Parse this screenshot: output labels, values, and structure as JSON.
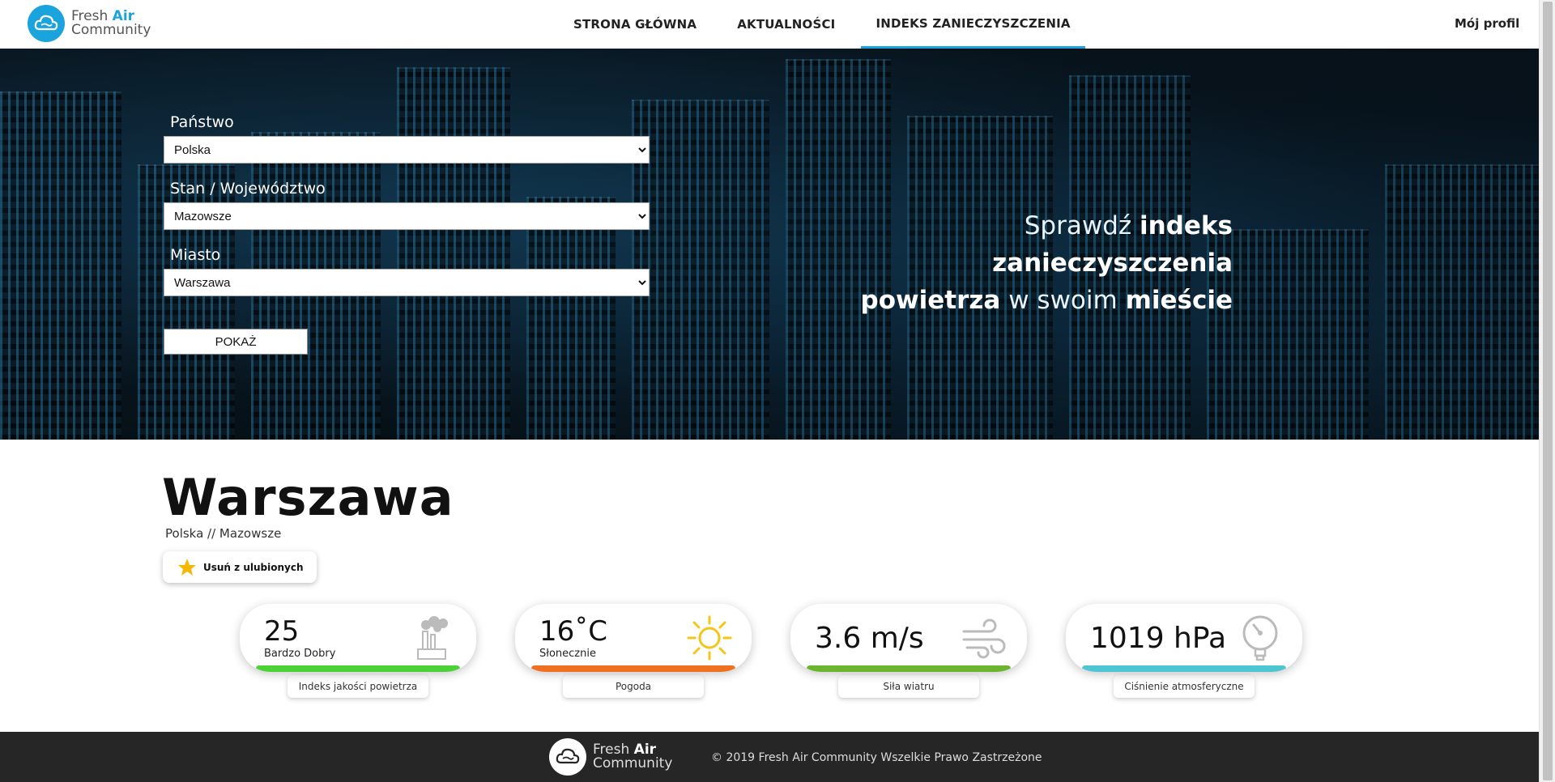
{
  "logo": {
    "line1_a": "Fresh",
    "line1_b": "Air",
    "line2": "Community"
  },
  "nav": {
    "items": [
      {
        "label": "STRONA GŁÓWNA"
      },
      {
        "label": "AKTUALNOŚCI"
      },
      {
        "label": "INDEKS ZANIECZYSZCZENIA"
      }
    ],
    "active_index": 2,
    "profile_label": "Mój profil"
  },
  "search_form": {
    "country_label": "Państwo",
    "country_value": "Polska",
    "state_label": "Stan / Województwo",
    "state_value": "Mazowsze",
    "city_label": "Miasto",
    "city_value": "Warszawa",
    "show_button": "POKAŻ"
  },
  "hero_text": {
    "part1": "Sprawdź ",
    "part2": "indeks zanieczyszczenia",
    "part3": "powietrza",
    "part4": " w swoim ",
    "part5": "mieście"
  },
  "city": {
    "name": "Warszawa",
    "breadcrumb": "Polska // Mazowsze",
    "favorite_button": "Usuń z ulubionych"
  },
  "cards": [
    {
      "value": "25",
      "sub": "Bardzo Dobry",
      "label": "Indeks jakości powietrza",
      "bar_color": "#4cd137",
      "icon": "factory-icon"
    },
    {
      "value": "16˚C",
      "sub": "Słonecznie",
      "label": "Pogoda",
      "bar_color": "#f07021",
      "icon": "sun-icon"
    },
    {
      "value": "3.6 m/s",
      "sub": "",
      "label": "Siła wiatru",
      "bar_color": "#6ab42e",
      "icon": "wind-icon"
    },
    {
      "value": "1019 hPa",
      "sub": "",
      "label": "Ciśnienie atmosferyczne",
      "bar_color": "#4ec5d3",
      "icon": "gauge-icon"
    }
  ],
  "footer": {
    "logo_line1_a": "Fresh",
    "logo_line1_b": "Air",
    "logo_line2": "Community",
    "copyright": "© 2019 Fresh Air Community Wszelkie Prawo Zastrzeżone"
  },
  "colors": {
    "accent": "#1ba3dd",
    "footer_bg": "#262626"
  }
}
